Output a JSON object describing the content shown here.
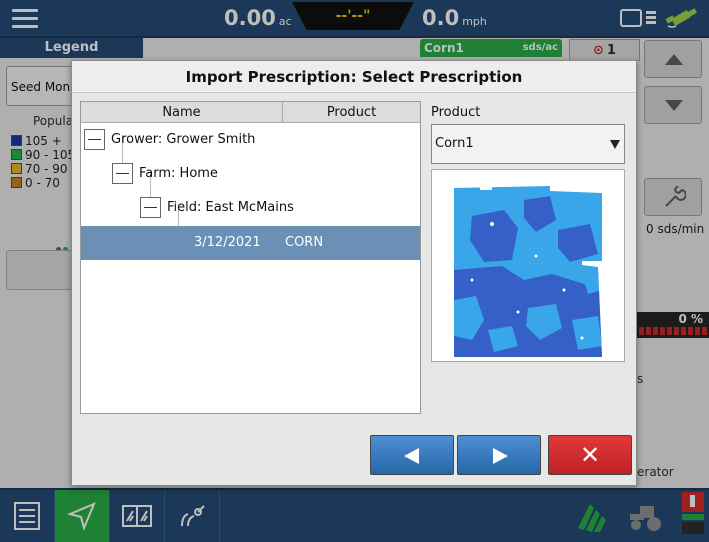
{
  "topbar": {
    "area_value": "0.00",
    "area_unit": "ac",
    "center_readout": "--'--\"",
    "speed_value": "0.0",
    "speed_unit": "mph"
  },
  "legend": {
    "tab_label": "Legend",
    "seed_monitor_label": "Seed Moni",
    "population_label": "Popula",
    "items": [
      {
        "label": "105 +",
        "color": "#0b2aa8"
      },
      {
        "label": "90 - 105",
        "color": "#19b14a"
      },
      {
        "label": "70 - 90",
        "color": "#e7b41a"
      },
      {
        "label": "0 - 70",
        "color": "#c77a18"
      }
    ]
  },
  "right_panel": {
    "product_tab": "Corn1",
    "product_tab_unit": "sds/ac",
    "counter": "1",
    "rate": "0 sds/min",
    "percent": "0 %",
    "partial_label_1": "s",
    "partial_label_2": "erator"
  },
  "dialog": {
    "title": "Import Prescription: Select Prescription",
    "tree_columns": {
      "name": "Name",
      "product": "Product"
    },
    "tree": {
      "grower": "Grower: Grower Smith",
      "farm": "Farm: Home",
      "field": "Field: East McMains",
      "prescription_date": "3/12/2021",
      "prescription_product": "CORN"
    },
    "product_label": "Product",
    "product_selected": "Corn1",
    "cancel_glyph": "✕"
  },
  "colors": {
    "brand_blue": "#17406d",
    "accent_green": "#1aa83a",
    "selected_row": "#6a90b6",
    "button_blue": "#2f78c2",
    "button_red": "#d12d2f",
    "map_light": "#3aa6ea",
    "map_dark": "#3460c8"
  },
  "icons": {
    "menu": "hamburger-menu-icon",
    "signal": "satellite-signal-icon",
    "back": "triangle-left-icon",
    "next": "triangle-right-icon",
    "cancel": "close-icon"
  }
}
